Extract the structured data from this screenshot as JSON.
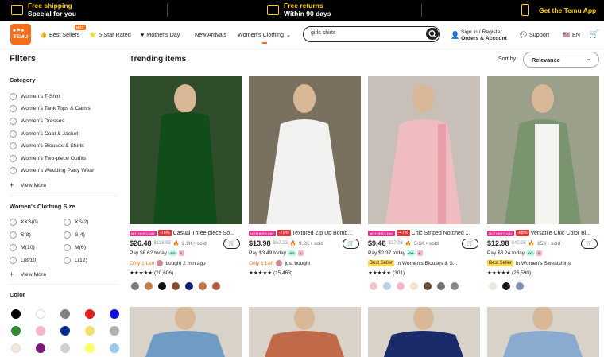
{
  "promo": {
    "free_shipping": "Free shipping",
    "special_for_you": "Special for you",
    "free_returns": "Free returns",
    "within_90_days": "Within 90 days",
    "get_app": "Get the Temu App"
  },
  "nav": {
    "logo_text": "TEMU",
    "best_sellers": "Best Sellers",
    "hot_badge": "HOT",
    "five_star": "5-Star Rated",
    "mothers_day": "Mother's Day",
    "new_arrivals": "New Arrivals",
    "womens_clothing": "Women's Clothing",
    "search_value": "girls shirts",
    "sign_in": "Sign in / Register",
    "orders_account": "Orders & Account",
    "support": "Support",
    "language": "EN"
  },
  "sidebar": {
    "filters": "Filters",
    "category_title": "Category",
    "categories": [
      "Women's T-Shirt",
      "Women's Tank Tops & Camis",
      "Women's Dresses",
      "Women's Coat & Jacket",
      "Women's Blouses & Shirts",
      "Women's Two-piece Outfits",
      "Women's Wedding Party Wear"
    ],
    "view_more_1": "View More",
    "size_title": "Women's Clothing Size",
    "sizes_left": [
      "XXS(0)",
      "S(8)",
      "M(10)",
      "L(8/10)"
    ],
    "sizes_right": [
      "XS(2)",
      "S(4)",
      "M(6)",
      "L(12)"
    ],
    "view_more_2": "View More",
    "color_title": "Color",
    "colors_row1": [
      "#000000",
      "#ffffff",
      "#808080",
      "#e02020",
      "#1010e0"
    ],
    "colors_row2": [
      "#2e8b2e",
      "#f5b5c5",
      "#0a2a8a",
      "#f0e070",
      "#b0b0b0"
    ],
    "colors_row3": [
      "#f2ead6",
      "#7a1a7a",
      "#d0d0d0",
      "#ffff66",
      "#a0c8e8"
    ]
  },
  "main": {
    "title": "Trending items",
    "sort_by": "Sort by",
    "sort_value": "Relevance"
  },
  "products": [
    {
      "title": "Casual Three-piece So...",
      "badge": "MOTHER'S DAY",
      "discount": "-76%",
      "price": "$26.48",
      "orig": "$118.99",
      "sold": "2.9K+ sold",
      "pay": "Pay $6.62 today",
      "line3a": "Only 1 Left",
      "line3b": "bought 2 min ago",
      "stars": "★★★★★",
      "reviews": "(20,606)",
      "img_bg": "#2f4d2a",
      "img_fig": "#114d1a",
      "dots": [
        "#7a7a7a",
        "#c08050",
        "#111111",
        "#8a4a30",
        "#0a1a6a",
        "#c07840",
        "#b06040"
      ]
    },
    {
      "title": "Textured Zip Up Bomb...",
      "badge": "MOTHER'S DAY",
      "discount": "-79%",
      "price": "$13.98",
      "orig": "$67.23",
      "sold": "9.2K+ sold",
      "pay": "Pay $3.49 today",
      "line3a": "Only 1 Left",
      "line3b": "just bought",
      "stars": "★★★★★",
      "reviews": "(15,463)",
      "img_bg": "#7a7060",
      "img_fig": "#f2f2f0",
      "dots": []
    },
    {
      "title": "Chic Striped Notched ...",
      "badge": "MOTHER'S DAY",
      "discount": "-47%",
      "price": "$9.48",
      "orig": "$17.98",
      "sold": "5.6K+ sold",
      "pay": "Pay $2.37 today",
      "line3a": "Best Seller",
      "line3b": "in Women's Blouses & S...",
      "stars": "★★★★★",
      "reviews": "(301)",
      "img_bg": "#c8c0b8",
      "img_fig": "#f0bcc0",
      "dots": [
        "#f0c8cc",
        "#b8d0e8",
        "#f4b8c8",
        "#f0e4d0",
        "#6a4a30",
        "#707070",
        "#8a8a8a"
      ]
    },
    {
      "title": "Versatile Chic Color Bl...",
      "badge": "MOTHER'S DAY",
      "discount": "-68%",
      "price": "$12.98",
      "orig": "$40.98",
      "sold": "15K+ sold",
      "pay": "Pay $3.24 today",
      "line3a": "Best Seller",
      "line3b": "in Women's Sweatshirts",
      "stars": "★★★★★",
      "reviews": "(26,590)",
      "img_bg": "#9aa08a",
      "img_fig": "#7a9470",
      "dots": [
        "#e8e8e0",
        "#1a1a1a",
        "#8090b0"
      ]
    }
  ]
}
